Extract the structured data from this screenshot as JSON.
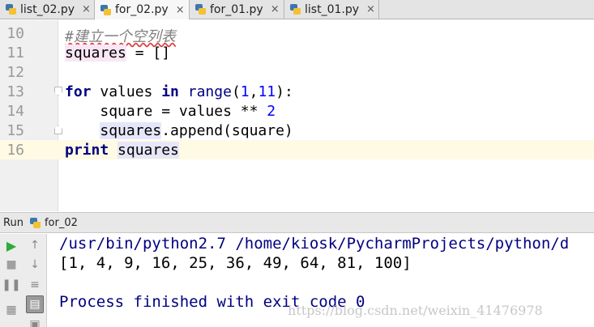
{
  "tabs": [
    {
      "label": "list_02.py",
      "active": false
    },
    {
      "label": "for_02.py",
      "active": true
    },
    {
      "label": "for_01.py",
      "active": false
    },
    {
      "label": "list_01.py",
      "active": false
    }
  ],
  "close_glyph": "×",
  "editor": {
    "current_line": 16,
    "lines": [
      {
        "num": "10"
      },
      {
        "num": "11"
      },
      {
        "num": "12"
      },
      {
        "num": "13"
      },
      {
        "num": "14"
      },
      {
        "num": "15"
      },
      {
        "num": "16"
      }
    ],
    "code": {
      "comment": "#建立一个空列表",
      "squares": "squares",
      "assign_empty": " = []",
      "kw_for": "for",
      "values": " values ",
      "kw_in": "in",
      "range": "range",
      "paren_open": "(",
      "n1": "1",
      "comma": ",",
      "n11": "11",
      "paren_close": "):",
      "indent": "    ",
      "square_assign": "square = values ** ",
      "n2": "2",
      "squares_var": "squares",
      "append_call": ".append(square)",
      "kw_print": "print",
      "space": " ",
      "squares_ref": "squares"
    }
  },
  "run_panel": {
    "label": "Run",
    "config_name": "for_02",
    "console": {
      "command": "/usr/bin/python2.7 /home/kiosk/PycharmProjects/python/d",
      "output": "[1, 4, 9, 16, 25, 36, 49, 64, 81, 100]",
      "exit_message": "Process finished with exit code 0"
    },
    "toolbar_icons": [
      "play-icon",
      "up-arrow-icon",
      "stop-icon",
      "down-arrow-icon",
      "pause-icon",
      "soft-wrap-icon",
      "layout-icon",
      "print-icon",
      "pin-icon"
    ]
  },
  "watermark": "https://blog.csdn.net/weixin_41476978"
}
